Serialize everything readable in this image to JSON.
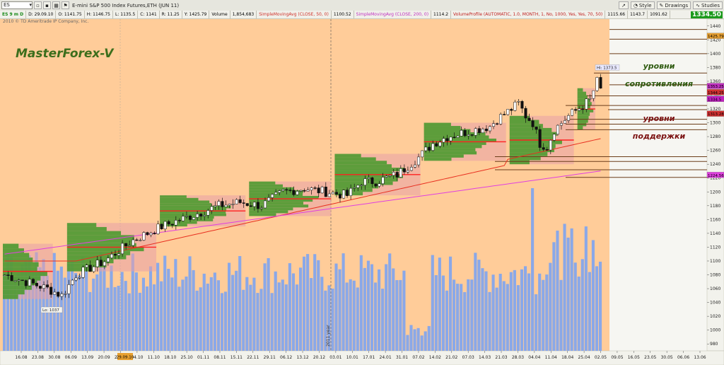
{
  "toolbar": {
    "symbol": "ES",
    "title": "E-mini S&P 500 Index Futures,ETH (JUN 11)",
    "style_label": "Style",
    "drawings_label": "Drawings",
    "studies_label": "Studies"
  },
  "infobar": {
    "symbol_period": "ES 9 m D",
    "date": "D: 29.09.10",
    "open": "O: 1141.75",
    "high": "H: 1146.75",
    "low": "L: 1135.5",
    "close": "C: 1141",
    "range": "R: 11.25",
    "y": "Y: 1425.79",
    "volume_label": "Volume",
    "volume_value": "1,854,683",
    "sma50_label": "SimpleMovingAvg (CLOSE, 50, 0)",
    "sma50_value": "1100.52",
    "sma200_label": "SimpleMovingAvg (CLOSE, 200, 0)",
    "sma200_value": "1114.2",
    "vp_label": "VolumeProfile (AUTOMATIC, 1.0, MONTH, 1, No, 1000, Yes, Yes, 70, 50)",
    "vp_value1": "1115.66",
    "vp_value2": "1143.7",
    "vp_value3": "1091.62"
  },
  "last_price": "1334.50",
  "copyright": "2010 © TD Ameritrade IP Company, Inc.",
  "watermark": "MasterForex-V",
  "labels": {
    "resistance1": "уровни",
    "resistance2": "сопротивления",
    "support1": "уровни",
    "support2": "поддержки",
    "high_label": "Hi: 1373.5",
    "low_label": "Lo: 1037",
    "year_label": "2011 year"
  },
  "price_axis": {
    "ticks": [
      1440,
      1420,
      1400,
      1380,
      1360,
      1340,
      1320,
      1300,
      1280,
      1260,
      1240,
      1220,
      1200,
      1180,
      1160,
      1140,
      1120,
      1100,
      1080,
      1060,
      1040,
      1020,
      1000,
      980
    ],
    "badges": [
      {
        "value": "1425.79",
        "color": "#e8a030"
      },
      {
        "value": "1353.25",
        "color": "#c030c0"
      },
      {
        "value": "1344.25",
        "color": "#d03030"
      },
      {
        "value": "1335",
        "color": "#ffffff"
      },
      {
        "value": "1334.5",
        "color": "#c020c0"
      },
      {
        "value": "1313.28",
        "color": "#d03030"
      },
      {
        "value": "1224.56",
        "color": "#e040e0"
      }
    ]
  },
  "date_axis": {
    "labels": [
      "16.08",
      "23.08",
      "30.08",
      "06.09",
      "13.09",
      "20.09",
      "27.09",
      "04.10",
      "11.10",
      "18.10",
      "25.10",
      "01.11",
      "08.11",
      "15.11",
      "22.11",
      "29.11",
      "06.12",
      "13.12",
      "20.12",
      "03.01",
      "10.01",
      "17.01",
      "24.01",
      "31.01",
      "07.02",
      "14.02",
      "21.02",
      "07.03",
      "14.03",
      "21.03",
      "28.03",
      "04.04",
      "11.04",
      "18.04",
      "25.04",
      "02.05",
      "09.05",
      "16.05",
      "23.05",
      "30.05",
      "06.06",
      "13.06"
    ],
    "highlighted": "29.09.10"
  },
  "colors": {
    "background": "#ffcc99",
    "future_area": "#f6f6f2",
    "candle_up": "#ffffff",
    "candle_down": "#111111",
    "volume": "#8aa8e8",
    "sma50": "#e83020",
    "sma200": "#e040e0",
    "profile_green": "#4c9a30",
    "profile_pink": "#e8a0a8",
    "watermark": "#3c6e1c",
    "level_line": "#6b3d1a",
    "support_text": "#7a1010",
    "resistance_text": "#2e5a10"
  }
}
